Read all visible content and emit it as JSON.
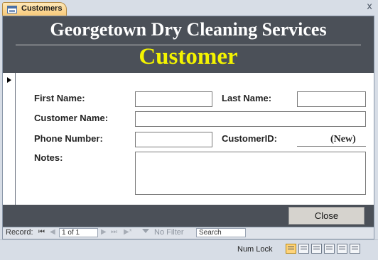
{
  "tab": {
    "label": "Customers",
    "close": "x"
  },
  "header": {
    "company": "Georgetown Dry Cleaning Services",
    "title": "Customer"
  },
  "fields": {
    "first_name_label": "First Name:",
    "last_name_label": "Last Name:",
    "customer_name_label": "Customer Name:",
    "phone_label": "Phone Number:",
    "customer_id_label": "CustomerID:",
    "customer_id_value": "(New)",
    "notes_label": "Notes:"
  },
  "footer": {
    "close_label": "Close"
  },
  "record_nav": {
    "record_label": "Record:",
    "position": "1 of 1",
    "first": "⏮",
    "prev": "◀",
    "next": "▶",
    "last": "⏭",
    "new": "▶*",
    "filter_label": "No Filter",
    "search_placeholder": "Search"
  },
  "status_bar": {
    "num_lock": "Num Lock"
  }
}
